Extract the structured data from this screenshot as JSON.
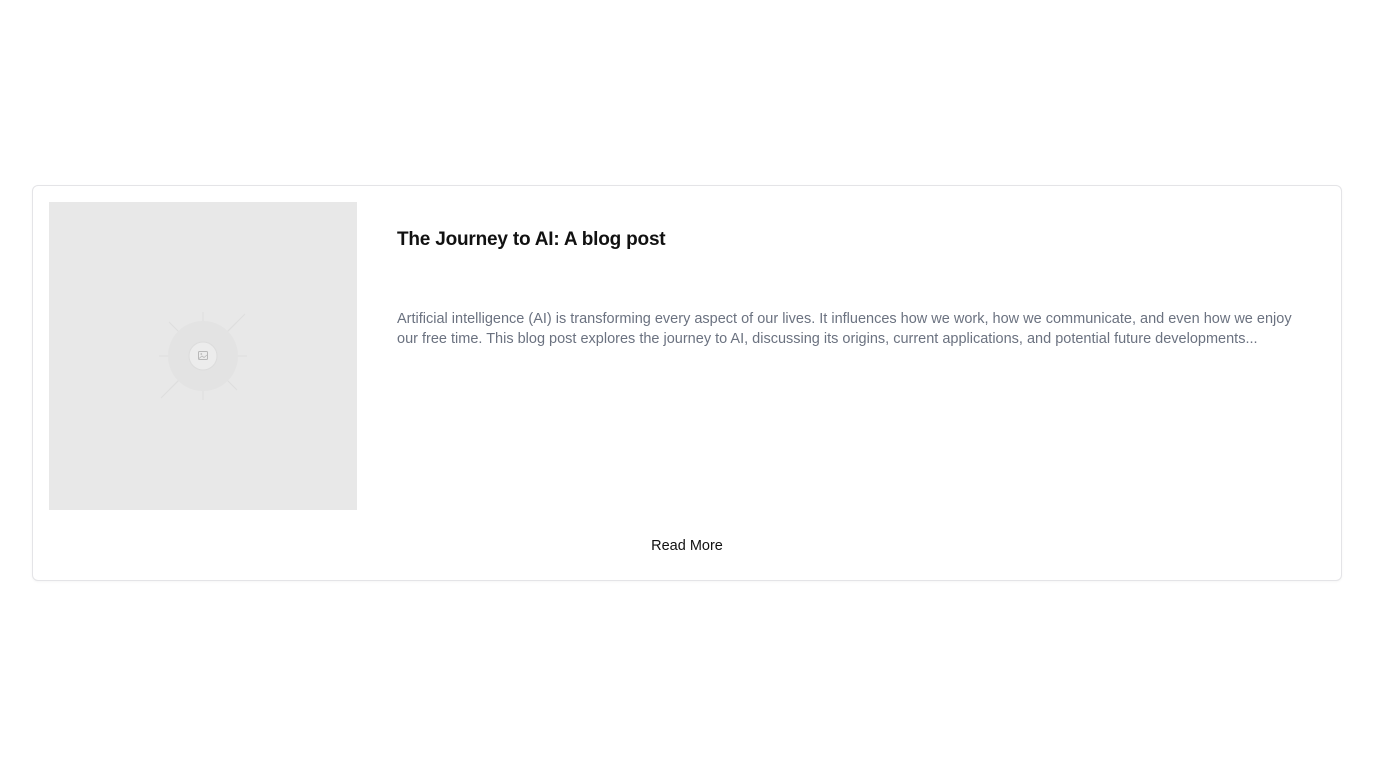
{
  "post": {
    "title": "The Journey to AI: A blog post",
    "excerpt": "Artificial intelligence (AI) is transforming every aspect of our lives. It influences how we work, how we communicate, and even how we enjoy our free time. This blog post explores the journey to AI, discussing its origins, current applications, and potential future developments...",
    "read_more_label": "Read More"
  },
  "icons": {
    "thumbnail_placeholder": "image-placeholder-icon"
  },
  "colors": {
    "thumbnail_bg": "#e8e8e8",
    "title": "#111111",
    "excerpt": "#6b7280",
    "card_border": "#e4e4e7"
  }
}
